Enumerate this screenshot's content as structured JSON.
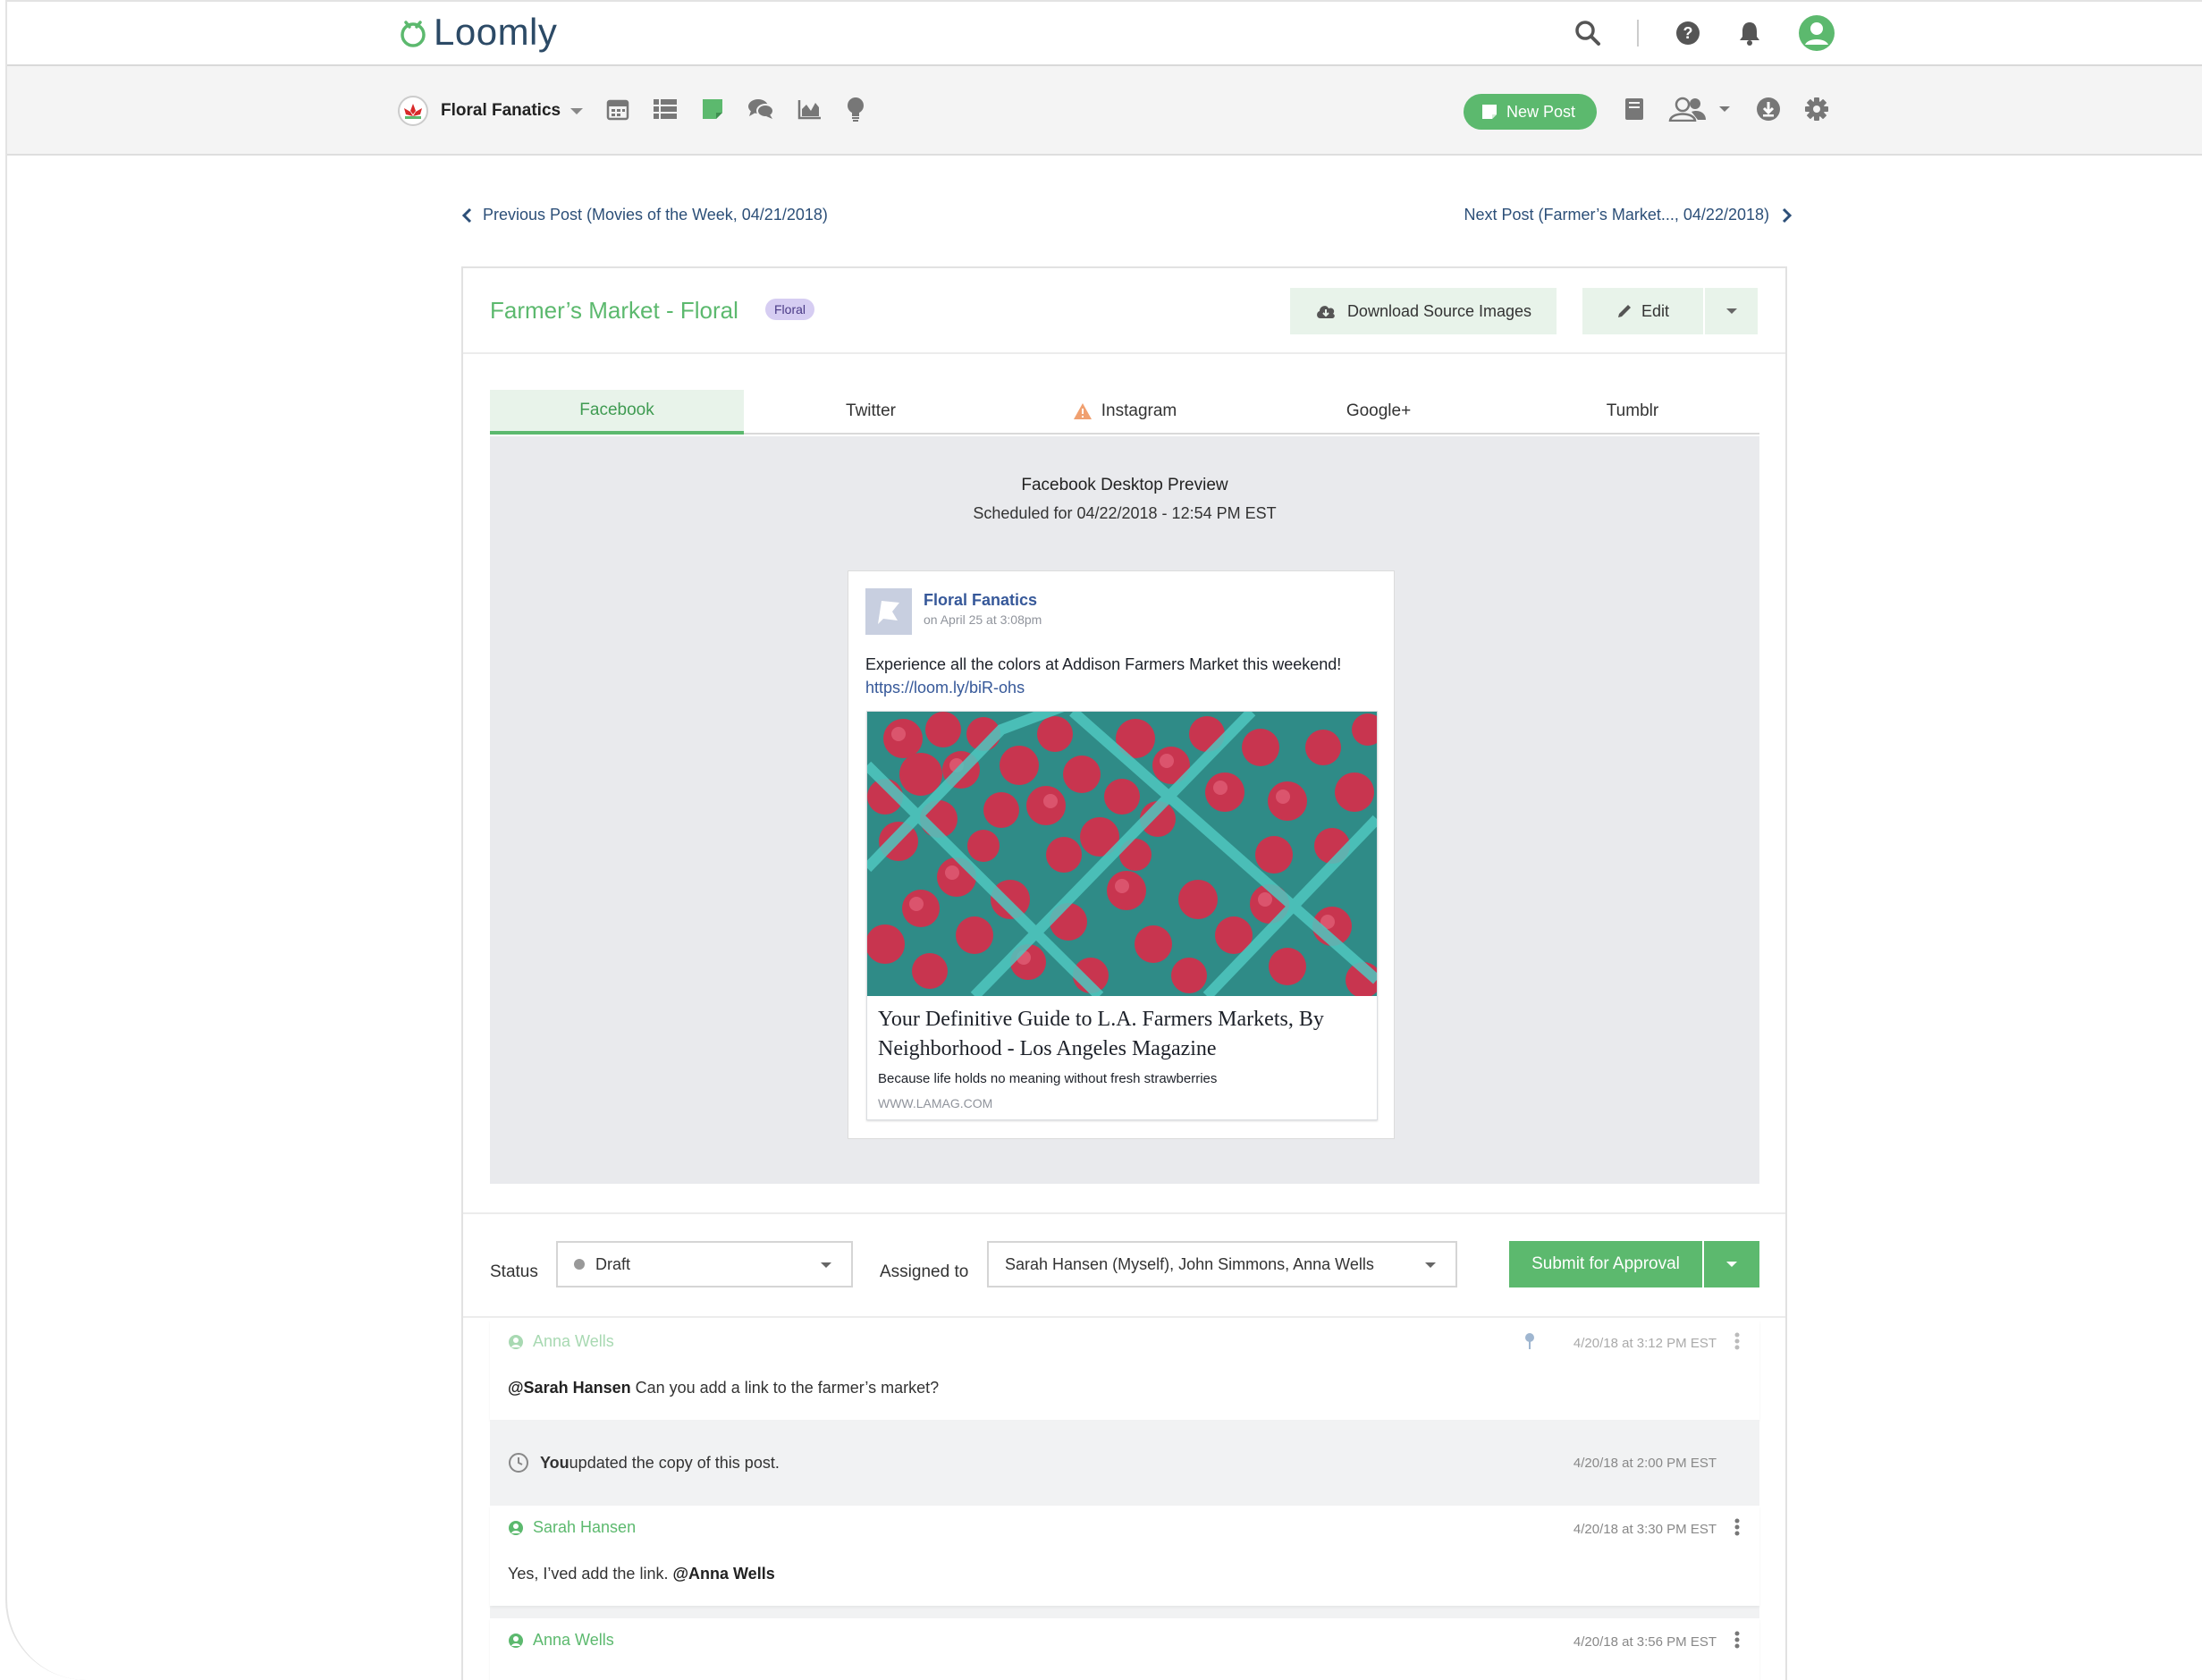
{
  "app": {
    "name": "Loomly"
  },
  "colors": {
    "brand_green": "#5cb96e",
    "navy": "#2c4a66",
    "tag_purple": "#d6cdf2"
  },
  "topbar": {
    "icons": [
      "search-icon",
      "help-icon",
      "bell-icon",
      "user-avatar-icon"
    ]
  },
  "toolbar": {
    "calendar_name": "Floral Fanatics",
    "new_post_label": "New Post",
    "view_icons": [
      "calendar-icon",
      "list-icon",
      "post-ideas-icon",
      "comments-icon",
      "analytics-icon",
      "lightbulb-icon"
    ],
    "right_icons": [
      "library-icon",
      "users-icon",
      "download-icon",
      "settings-icon"
    ]
  },
  "post_nav": {
    "previous": "Previous Post (Movies of the Week, 04/21/2018)",
    "next": "Next Post (Farmer’s Market..., 04/22/2018)"
  },
  "post": {
    "title": "Farmer’s Market - Floral",
    "tag": "Floral",
    "download_label": "Download Source Images",
    "edit_label": "Edit"
  },
  "tabs": [
    {
      "label": "Facebook",
      "active": true
    },
    {
      "label": "Twitter",
      "active": false
    },
    {
      "label": "Instagram",
      "active": false,
      "warning": true
    },
    {
      "label": "Google+",
      "active": false
    },
    {
      "label": "Tumblr",
      "active": false
    }
  ],
  "preview": {
    "title": "Facebook Desktop Preview",
    "scheduled": "Scheduled for 04/22/2018 - 12:54 PM EST",
    "page_name": "Floral Fanatics",
    "post_date": "on April 25 at 3:08pm",
    "text": "Experience all the colors at Addison Farmers Market this weekend!",
    "link": "https://loom.ly/biR-ohs",
    "headline": "Your Definitive Guide to L.A. Farmers Markets, By Neighborhood - Los Angeles Magazine",
    "description": "Because life holds no meaning without fresh strawberries",
    "domain": "WWW.LAMAG.COM"
  },
  "status": {
    "label": "Status",
    "value": "Draft",
    "assigned_label": "Assigned to",
    "assigned_value": "Sarah Hansen (Myself), John Simmons, Anna Wells",
    "submit_label": "Submit for Approval"
  },
  "feed": {
    "c1": {
      "author": "Anna Wells",
      "time": "4/20/18 at 3:12 PM EST",
      "mention": "@Sarah Hansen",
      "text": " Can you add a link to the farmer’s market?"
    },
    "sys": {
      "actor": "You",
      "text": " updated the copy of this post.",
      "time": "4/20/18 at 2:00 PM EST"
    },
    "c2": {
      "author": "Sarah Hansen",
      "time": "4/20/18 at 3:30 PM EST",
      "text": "Yes, I’ved add the link. ",
      "mention": "@Anna Wells"
    },
    "c3": {
      "author": "Anna Wells",
      "time": "4/20/18 at 3:56 PM EST"
    }
  }
}
